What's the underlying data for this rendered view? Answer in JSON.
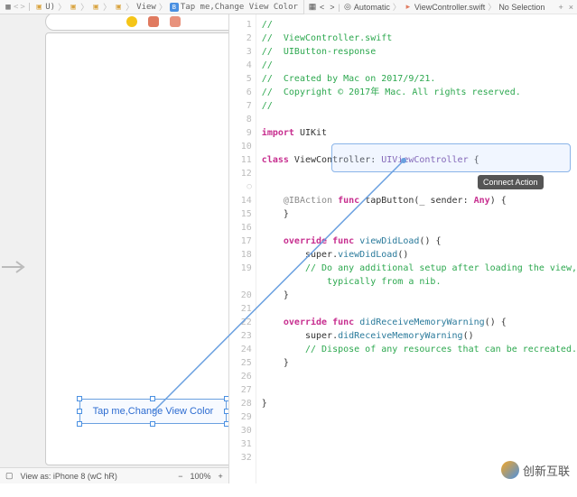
{
  "left_bc": {
    "items": [
      "U)",
      "",
      "",
      "",
      "View",
      "B",
      "Tap me,Change View Color"
    ]
  },
  "right_bc": {
    "nav_back": "<",
    "nav_fwd": ">",
    "items": [
      "Automatic",
      "ViewController.swift",
      "No Selection"
    ],
    "add": "+",
    "close": "×"
  },
  "ib": {
    "button_label": "Tap me,Change View Color",
    "arrow": "→"
  },
  "bottom": {
    "device_icon": "▢",
    "view_as": "View as: iPhone 8 (wC hR)",
    "zoom_out": "−",
    "zoom": "100%",
    "zoom_in": "+"
  },
  "tooltip": "Connect Action",
  "code": {
    "lines": [
      {
        "n": "1",
        "t": "comment",
        "txt": "//"
      },
      {
        "n": "2",
        "t": "comment",
        "txt": "//  ViewController.swift"
      },
      {
        "n": "3",
        "t": "comment",
        "txt": "//  UIButton-response"
      },
      {
        "n": "4",
        "t": "comment",
        "txt": "//"
      },
      {
        "n": "5",
        "t": "comment",
        "txt": "//  Created by Mac on 2017/9/21."
      },
      {
        "n": "6",
        "t": "comment",
        "txt": "//  Copyright © 2017年 Mac. All rights reserved."
      },
      {
        "n": "7",
        "t": "comment",
        "txt": "//"
      },
      {
        "n": "8",
        "t": "blank",
        "txt": ""
      },
      {
        "n": "9",
        "t": "import",
        "kw": "import",
        "rest": " UIKit"
      },
      {
        "n": "10",
        "t": "blank",
        "txt": ""
      },
      {
        "n": "11",
        "t": "classdecl",
        "kw": "class",
        "name": " ViewController: ",
        "type": "UIViewController",
        "end": " {"
      },
      {
        "n": "12",
        "t": "blank",
        "txt": ""
      },
      {
        "n": "○",
        "t": "blank",
        "txt": ""
      },
      {
        "n": "14",
        "t": "ibaction",
        "ib": "@IBAction",
        "kw": " func ",
        "fn": "tapButton",
        "sig": "(_ sender: ",
        "any": "Any",
        "end": ") {"
      },
      {
        "n": "15",
        "t": "plain",
        "txt": "    }"
      },
      {
        "n": "16",
        "t": "blank",
        "txt": ""
      },
      {
        "n": "17",
        "t": "override",
        "kw1": "override func ",
        "fn": "viewDidLoad",
        "end": "() {"
      },
      {
        "n": "18",
        "t": "super",
        "pre": "        super.",
        "call": "viewDidLoad",
        "end": "()"
      },
      {
        "n": "19",
        "t": "comment2",
        "txt": "        // Do any additional setup after loading the view,"
      },
      {
        "n": "",
        "t": "comment2",
        "txt": "            typically from a nib."
      },
      {
        "n": "20",
        "t": "plain",
        "txt": "    }"
      },
      {
        "n": "21",
        "t": "blank",
        "txt": ""
      },
      {
        "n": "22",
        "t": "override",
        "kw1": "override func ",
        "fn": "didReceiveMemoryWarning",
        "end": "() {"
      },
      {
        "n": "23",
        "t": "super",
        "pre": "        super.",
        "call": "didReceiveMemoryWarning",
        "end": "()"
      },
      {
        "n": "24",
        "t": "comment2",
        "txt": "        // Dispose of any resources that can be recreated."
      },
      {
        "n": "25",
        "t": "plain",
        "txt": "    }"
      },
      {
        "n": "26",
        "t": "blank",
        "txt": ""
      },
      {
        "n": "27",
        "t": "blank",
        "txt": ""
      },
      {
        "n": "28",
        "t": "plain",
        "txt": "}"
      },
      {
        "n": "29",
        "t": "blank",
        "txt": ""
      },
      {
        "n": "30",
        "t": "blank",
        "txt": ""
      },
      {
        "n": "31",
        "t": "blank",
        "txt": ""
      },
      {
        "n": "32",
        "t": "blank",
        "txt": ""
      }
    ]
  },
  "watermark": "创新互联"
}
